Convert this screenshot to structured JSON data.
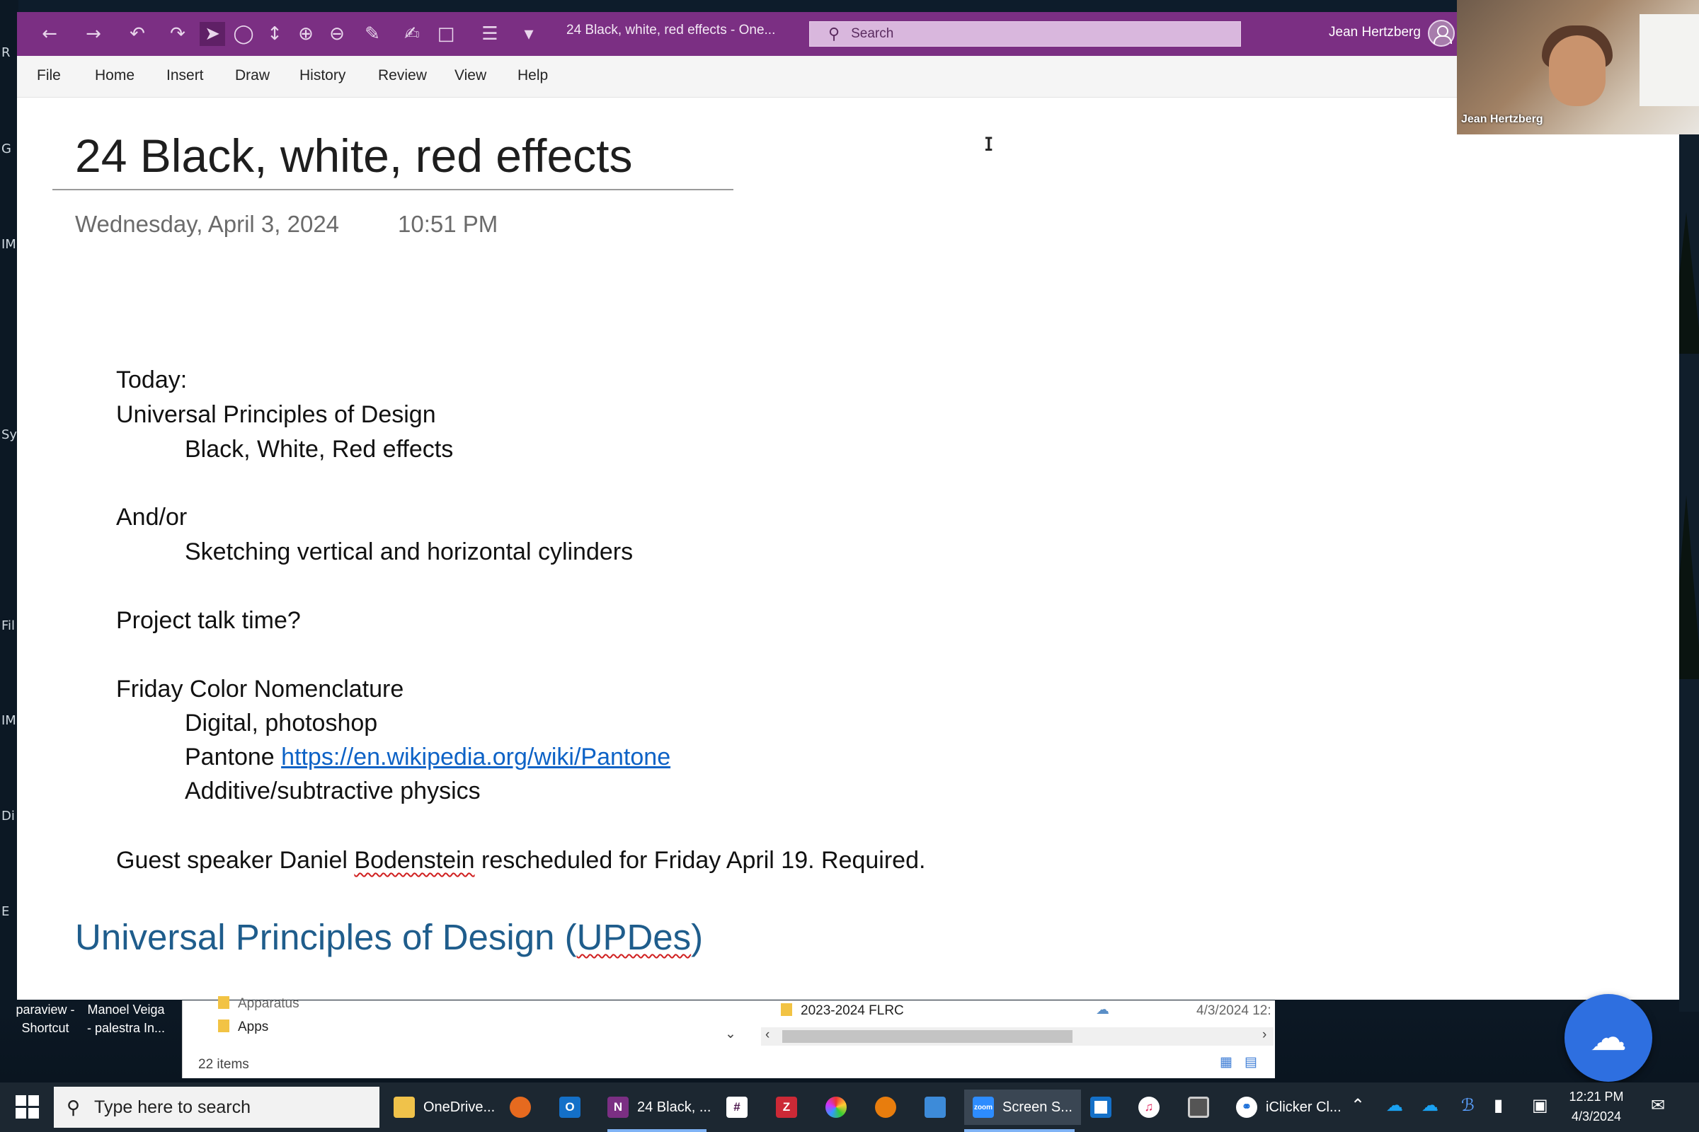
{
  "window": {
    "doc_title": "24 Black, white, red effects  -  One...",
    "search_placeholder": "Search",
    "user_name": "Jean Hertzberg",
    "accent": "#7b2f83"
  },
  "menu": [
    "File",
    "Home",
    "Insert",
    "Draw",
    "History",
    "Review",
    "View",
    "Help"
  ],
  "video": {
    "participant": "Jean Hertzberg"
  },
  "page": {
    "title": "24 Black, white, red effects",
    "date": "Wednesday, April 3, 2024",
    "time": "10:51 PM",
    "lines": {
      "today": "Today:",
      "upd": "Universal Principles of Design",
      "bwr": "Black, White, Red effects",
      "andor": "And/or",
      "sketch": "Sketching vertical and horizontal cylinders",
      "project": "Project talk time?",
      "friday": "Friday Color Nomenclature",
      "digital": "Digital, photoshop",
      "pantone": "Pantone ",
      "pantone_link": "https://en.wikipedia.org/wiki/Pantone",
      "additive": "Additive/subtractive physics",
      "guest_a": "Guest speaker Daniel ",
      "guest_b": "Bodenstein",
      "guest_c": " rescheduled for Friday April 19. Required."
    },
    "heading_a": "Universal Principles of Design (",
    "heading_b": "UPDes",
    "heading_c": ")",
    "heading_color": "#1f5d8c"
  },
  "desktop": {
    "icon1": [
      "paraview -",
      "Shortcut"
    ],
    "icon2": [
      "Manoel Veiga",
      "- palestra In..."
    ]
  },
  "explorer": {
    "item_top": "Apparatus",
    "item_apps": "Apps",
    "item_count": "22 items",
    "file_name": "2023-2024 FLRC",
    "file_date": "4/3/2024 12:"
  },
  "taskbar": {
    "search_placeholder": "Type here to search",
    "apps": {
      "onedrive": "OneDrive...",
      "onenote": "24 Black, ...",
      "zoom": "Screen S...",
      "iclicker": "iClicker Cl..."
    },
    "time": "12:21 PM",
    "date": "4/3/2024"
  }
}
